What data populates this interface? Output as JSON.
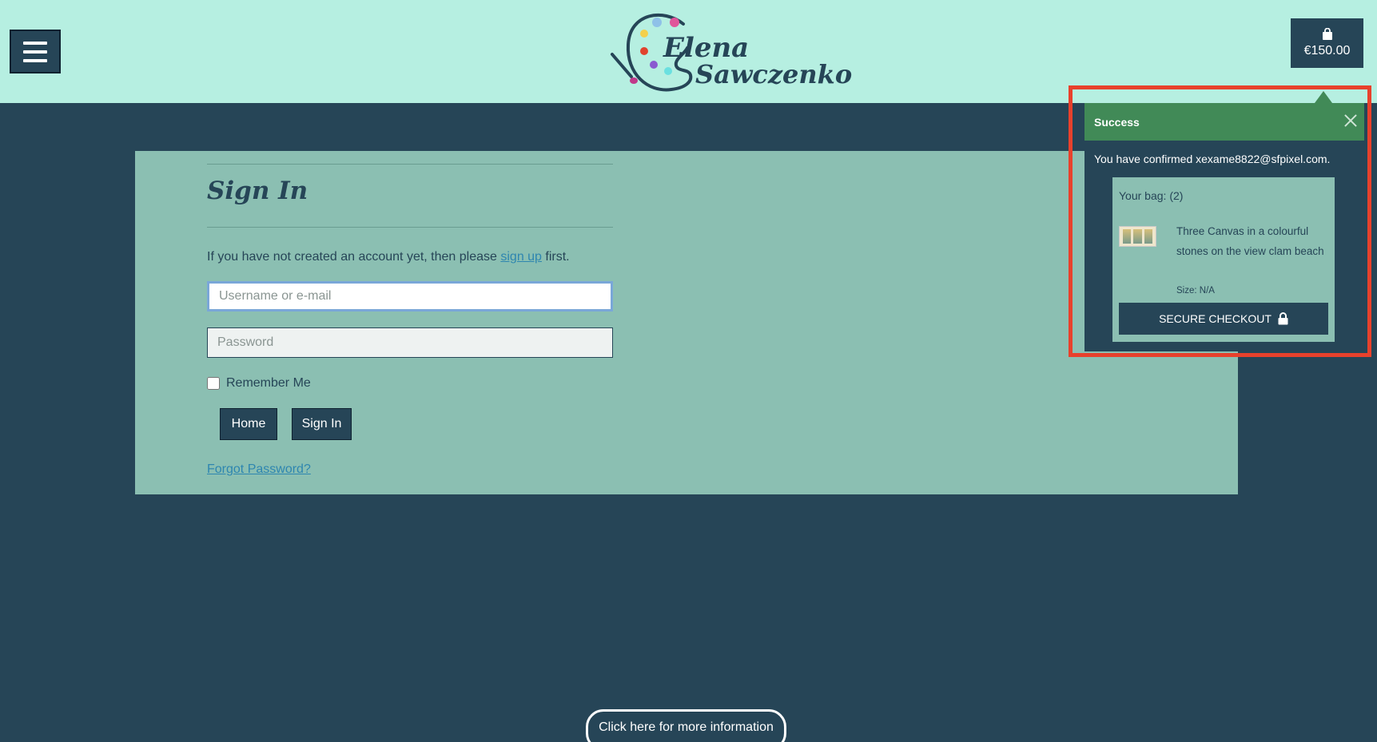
{
  "header": {
    "logo_line1": "Elena",
    "logo_line2": "Sawczenko",
    "bag_total": "€150.00",
    "menu_icon": "hamburger-icon",
    "bag_icon": "shopping-bag-icon"
  },
  "signin": {
    "title": "Sign In",
    "intro_before": "If you have not created an account yet, then please ",
    "intro_link": "sign up",
    "intro_after": " first.",
    "username_placeholder": "Username or e-mail",
    "password_placeholder": "Password",
    "remember_label": "Remember Me",
    "home_button": "Home",
    "signin_button": "Sign In",
    "forgot_link": "Forgot Password?"
  },
  "toast": {
    "title": "Success",
    "message": "You have confirmed xexame8822@sfpixel.com.",
    "bag_count": "Your bag: (2)",
    "item_name": "Three Canvas in a colourful stones on the view clam beach",
    "item_size": "Size: N/A",
    "checkout_label": "SECURE CHECKOUT",
    "checkout_icon": "lock-icon"
  },
  "footer": {
    "info_button": "Click here for more information"
  },
  "colors": {
    "header_bg": "#b6efe1",
    "page_bg": "#264557",
    "panel_bg": "#8bbfb2",
    "success_green": "#418a57",
    "highlight_red": "#e8412c",
    "link_blue": "#2e86b0"
  }
}
